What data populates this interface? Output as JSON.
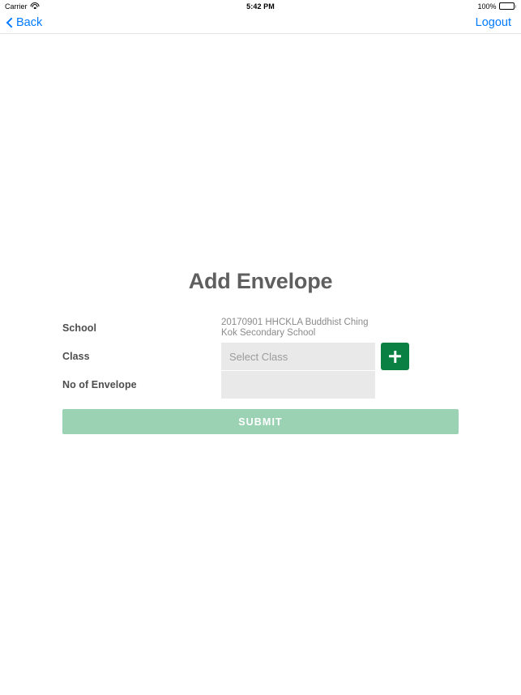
{
  "status_bar": {
    "carrier": "Carrier",
    "wifi_icon": "wifi-icon",
    "time": "5:42 PM",
    "battery_percent": "100%",
    "battery_icon": "battery-full-icon"
  },
  "nav_bar": {
    "back_label": "Back",
    "back_icon": "chevron-left-icon",
    "logout_label": "Logout"
  },
  "page": {
    "title": "Add Envelope"
  },
  "form": {
    "school": {
      "label": "School",
      "value": "20170901 HHCKLA Buddhist Ching Kok Secondary School"
    },
    "class": {
      "label": "Class",
      "value": "",
      "placeholder": "Select Class",
      "add_button_icon": "plus-icon"
    },
    "envelope_count": {
      "label": "No of Envelope",
      "value": "",
      "placeholder": ""
    },
    "submit_label": "SUBMIT"
  },
  "colors": {
    "accent_blue": "#007aff",
    "add_green": "#0a8043",
    "submit_green": "#9bd2b4",
    "input_gray": "#e9e9e9",
    "title_gray": "#5f5f5f"
  }
}
